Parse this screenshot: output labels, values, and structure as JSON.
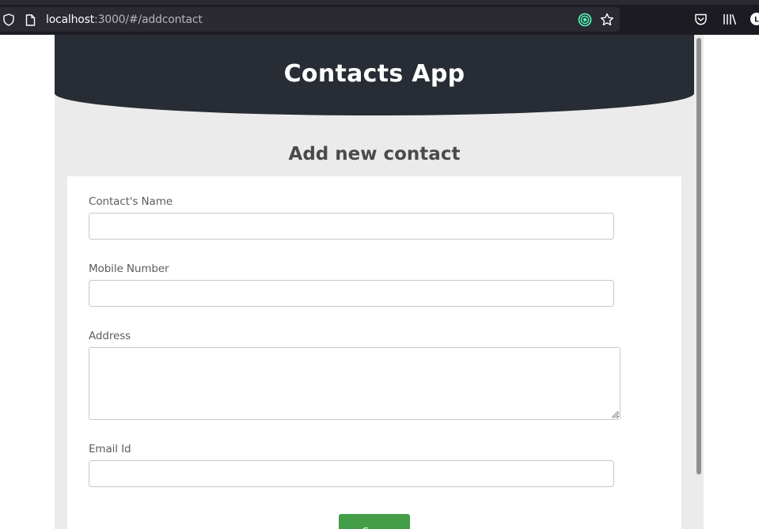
{
  "browser": {
    "url_host": "localhost",
    "url_rest": ":3000/#/addcontact",
    "icons": [
      "shield-icon",
      "page-icon",
      "extension-icon",
      "star-icon",
      "pocket-icon",
      "library-icon",
      "account-icon"
    ]
  },
  "app": {
    "title": "Contacts App"
  },
  "form": {
    "title": "Add new contact",
    "fields": {
      "name_label": "Contact's Name",
      "name_value": "",
      "mobile_label": "Mobile Number",
      "mobile_value": "",
      "address_label": "Address",
      "address_value": "",
      "email_label": "Email Id",
      "email_value": ""
    },
    "save_label": "Save"
  },
  "colors": {
    "header_bg": "#282c34",
    "page_bg": "#ebebeb",
    "save_button": "#449e48",
    "browser_toolbar": "#1c1b22"
  }
}
